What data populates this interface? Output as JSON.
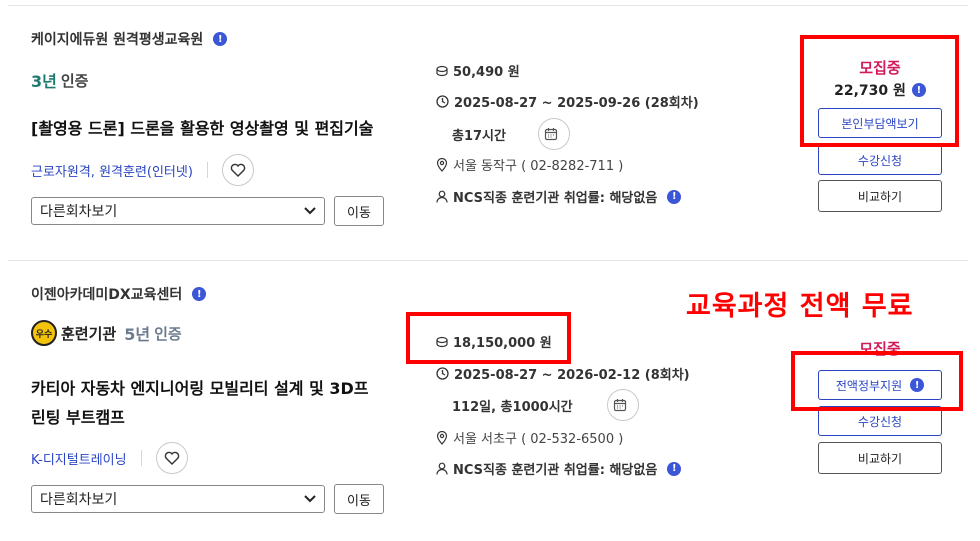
{
  "courses": [
    {
      "provider": "케이지에듀원 원격평생교육원",
      "cert_years": "3년",
      "cert_label": "인증",
      "title_lines": [
        "[촬영용 드론] 드론을 활용한 영상촬영 및 편집기술"
      ],
      "tags": [
        "근로자원격, 원격훈련(인터넷)"
      ],
      "select_value": "다른회차보기",
      "move_label": "이동",
      "price": "50,490 원",
      "period": "2025-08-27 ~ 2025-09-26 (28회차)",
      "hours": "총17시간",
      "location": "서울 동작구 ( 02-8282-711 )",
      "ncs": "NCS직종 훈련기관 취업률: 해당없음",
      "status": "모집중",
      "self_price": "22,730 원",
      "primary_button": "본인부담액보기",
      "enroll_button": "수강신청",
      "compare_button": "비교하기"
    },
    {
      "provider": "이젠아카데미DX교육센터",
      "badge_label": "우수",
      "badge_text": "훈련기관",
      "cert_years": "5년",
      "cert_label": "인증",
      "title_lines": [
        "카티아 자동차 엔지니어링 모빌리티 설계 및 3D프",
        "린팅 부트캠프"
      ],
      "tags": [
        "K-디지털트레이닝"
      ],
      "select_value": "다른회차보기",
      "move_label": "이동",
      "price": "18,150,000 원",
      "period": "2025-08-27 ~ 2026-02-12 (8회차)",
      "hours": "112일, 총1000시간",
      "location": "서울 서초구 ( 02-532-6500 )",
      "ncs": "NCS직종 훈련기관 취업률: 해당없음",
      "status": "모집중",
      "primary_button": "전액정부지원",
      "enroll_button": "수강신청",
      "compare_button": "비교하기"
    }
  ],
  "overlay_text": "교육과정 전액 무료",
  "colors": {
    "accent_blue": "#2a44c4",
    "status_pink": "#d21a5b",
    "annotation_red": "#ff0000",
    "cert_green": "#1f7a6f"
  },
  "icons": [
    "info-icon",
    "heart-icon",
    "coin-icon",
    "clock-icon",
    "calendar-icon",
    "location-pin-icon",
    "person-icon",
    "chevron-down-icon"
  ]
}
